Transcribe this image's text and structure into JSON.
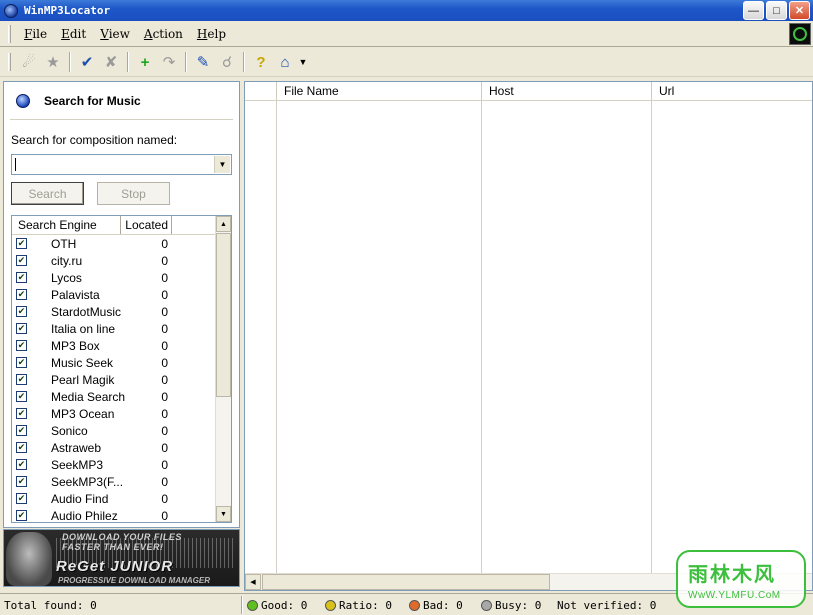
{
  "window": {
    "title": "WinMP3Locator"
  },
  "menu": [
    "File",
    "Edit",
    "View",
    "Action",
    "Help"
  ],
  "toolbar_icons": [
    "run-icon",
    "run-all-icon",
    "check-icon",
    "uncheck-icon",
    "add-icon",
    "edit-icon",
    "download-icon",
    "connect-icon",
    "help-icon",
    "home-icon",
    "dropdown-arrow-icon"
  ],
  "search_panel": {
    "title": "Search for Music",
    "label": "Search for composition named:",
    "input_value": "",
    "search_button": "Search",
    "stop_button": "Stop",
    "columns": [
      "Search Engine",
      "Located"
    ],
    "engines": [
      {
        "name": "OTH",
        "located": "0",
        "checked": true
      },
      {
        "name": "city.ru",
        "located": "0",
        "checked": true
      },
      {
        "name": "Lycos",
        "located": "0",
        "checked": true
      },
      {
        "name": "Palavista",
        "located": "0",
        "checked": true
      },
      {
        "name": "StardotMusic",
        "located": "0",
        "checked": true
      },
      {
        "name": "Italia on line",
        "located": "0",
        "checked": true
      },
      {
        "name": "MP3 Box",
        "located": "0",
        "checked": true
      },
      {
        "name": "Music Seek",
        "located": "0",
        "checked": true
      },
      {
        "name": "Pearl Magik",
        "located": "0",
        "checked": true
      },
      {
        "name": "Media Search",
        "located": "0",
        "checked": true
      },
      {
        "name": "MP3 Ocean",
        "located": "0",
        "checked": true
      },
      {
        "name": "Sonico",
        "located": "0",
        "checked": true
      },
      {
        "name": "Astraweb",
        "located": "0",
        "checked": true
      },
      {
        "name": "SeekMP3",
        "located": "0",
        "checked": true
      },
      {
        "name": "SeekMP3(F...",
        "located": "0",
        "checked": true
      },
      {
        "name": "Audio Find",
        "located": "0",
        "checked": true
      },
      {
        "name": "Audio Philez",
        "located": "0",
        "checked": true
      }
    ]
  },
  "banner": {
    "line1": "DOWNLOAD YOUR FILES",
    "line2": "FASTER THAN EVER!",
    "line3": "ReGet JUNIOR",
    "line4": "PROGRESSIVE DOWNLOAD MANAGER"
  },
  "results": {
    "columns": [
      "File Name",
      "Host",
      "Url"
    ]
  },
  "status": {
    "total": "Total found: 0",
    "good": "Good: 0",
    "ratio": "Ratio: 0",
    "bad": "Bad: 0",
    "busy": "Busy: 0",
    "not_verified": "Not verified: 0"
  },
  "status_colors": {
    "good": "#5fbf1f",
    "ratio": "#d8c21a",
    "bad": "#e06a2a",
    "busy": "#a8a8a8"
  },
  "watermark": {
    "line1": "雨林木风",
    "line2": "WwW.YLMFU.CoM"
  }
}
